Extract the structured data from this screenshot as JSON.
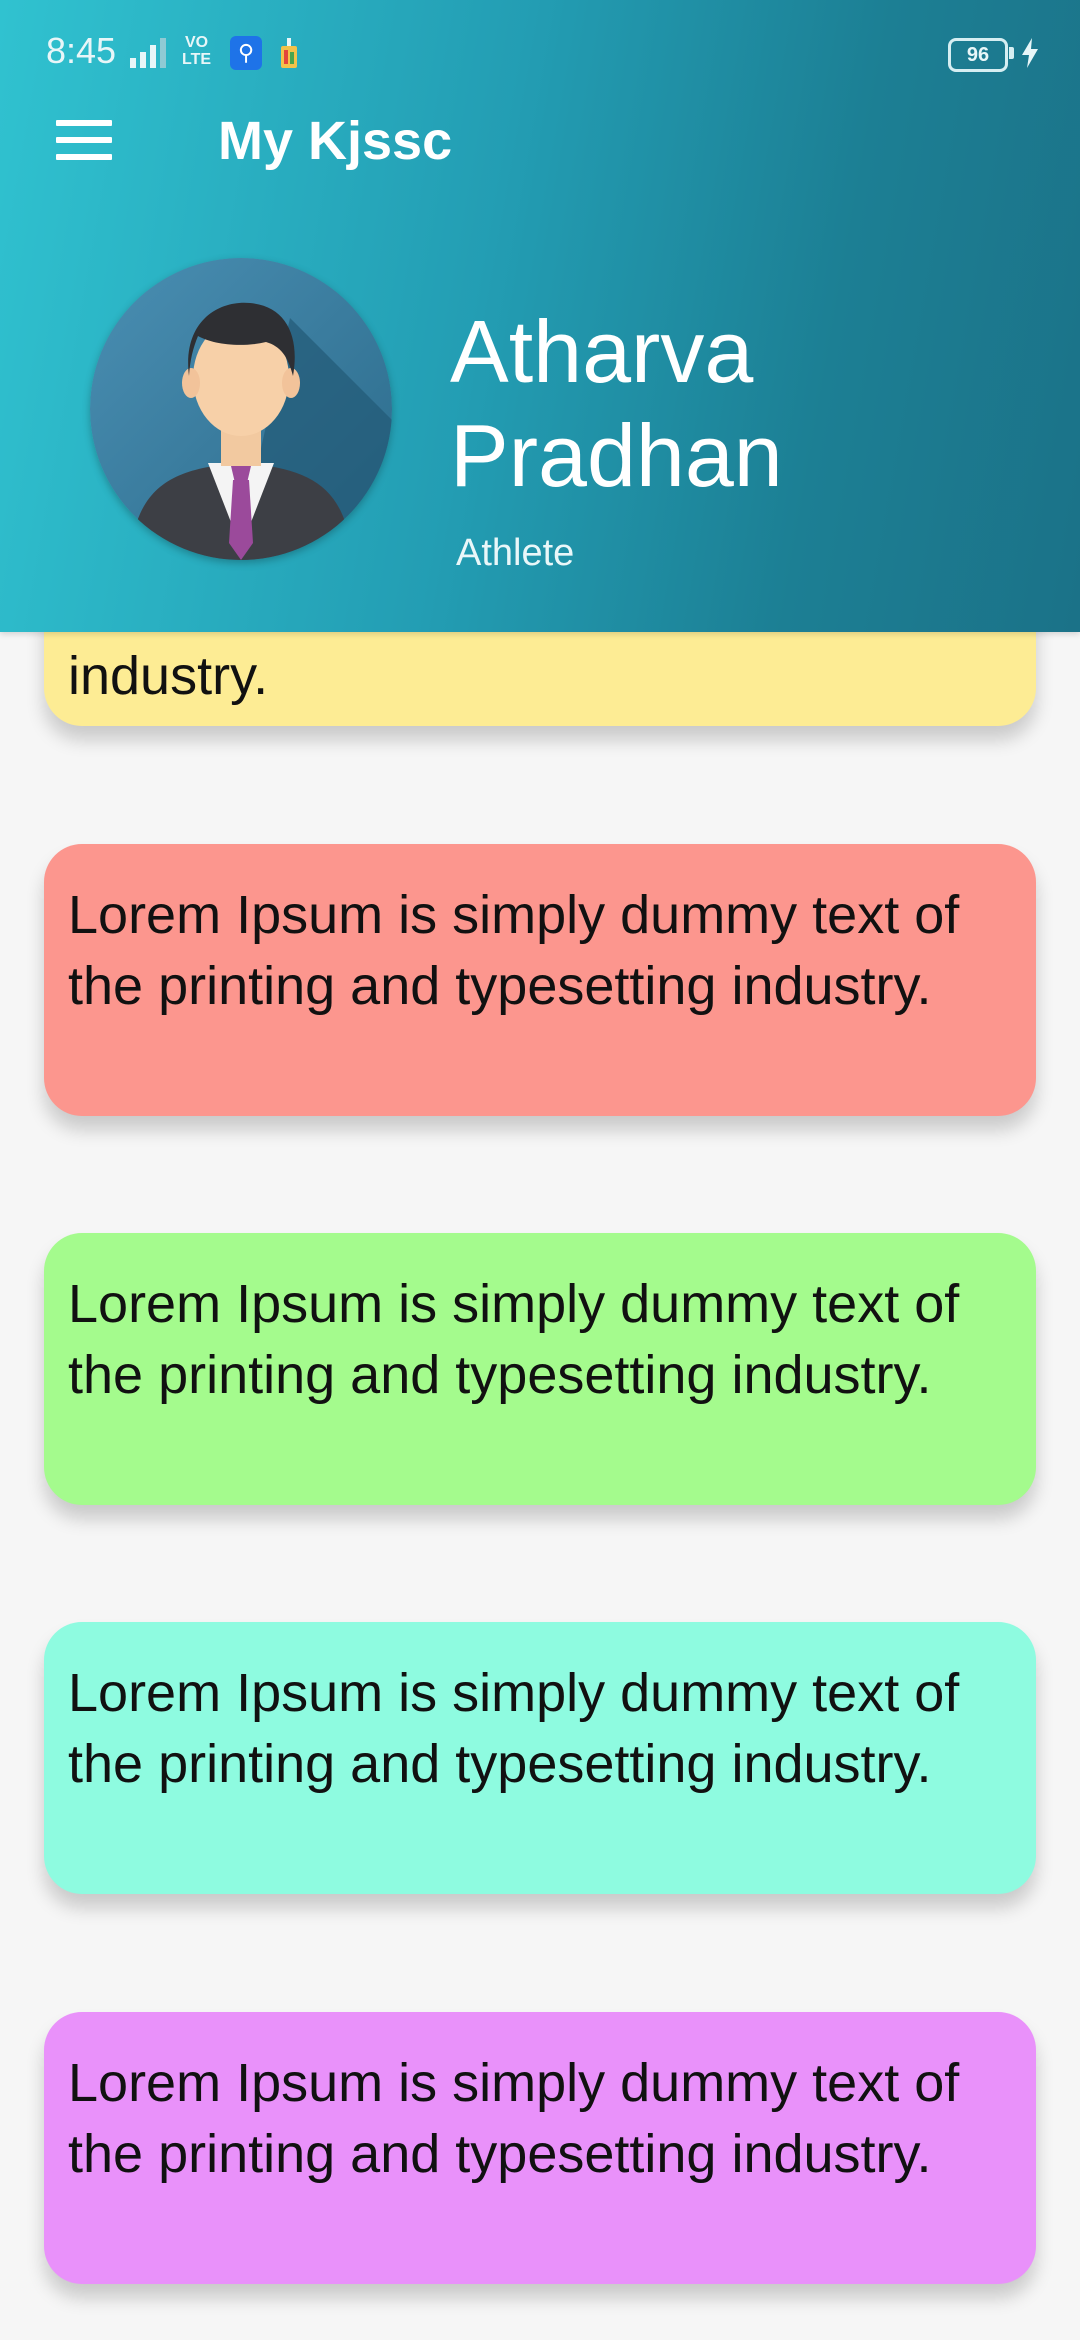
{
  "status_bar": {
    "time": "8:45",
    "network": "VO LTE",
    "battery": "96"
  },
  "app_bar": {
    "title": "My Kjssc",
    "menu_icon": "hamburger-menu-icon"
  },
  "profile": {
    "name_line1": "Atharva",
    "name_line2": "Pradhan",
    "role": "Athlete",
    "avatar_icon": "user-avatar"
  },
  "cards": [
    {
      "text": "Lorem Ipsum is simply dummy text of the printing and typesetting industry.",
      "color": "#fdec94"
    },
    {
      "text": "Lorem Ipsum is simply dummy text of the printing and typesetting industry.",
      "color": "#fc968e"
    },
    {
      "text": "Lorem Ipsum is simply dummy text of the printing and typesetting industry.",
      "color": "#a4fb8d"
    },
    {
      "text": "Lorem Ipsum is simply dummy text of the printing and typesetting industry.",
      "color": "#8efbe0"
    },
    {
      "text": "Lorem Ipsum is simply dummy text of the printing and typesetting industry.",
      "color": "#e991fa"
    }
  ],
  "colors": {
    "header_start": "#30c2d0",
    "header_end": "#1b7288",
    "background": "#f6f6f6"
  }
}
